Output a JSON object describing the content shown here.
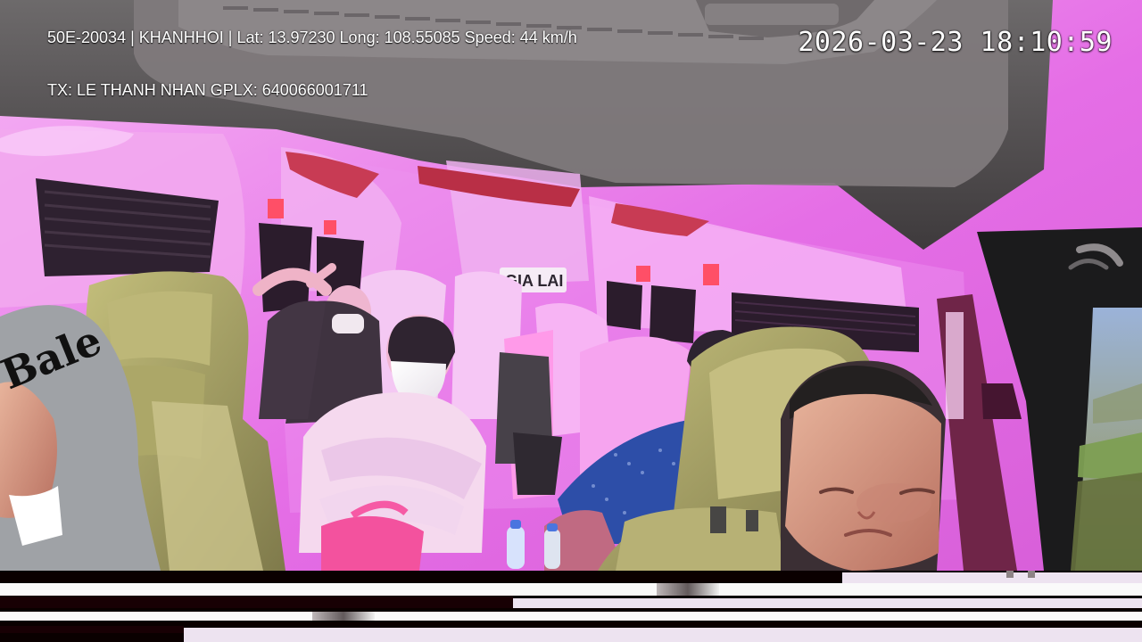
{
  "overlay": {
    "line1": "50E-20034 | KHANHHOI | Lat: 13.97230 Long: 108.55085 Speed: 44 km/h",
    "line2": "TX: LE THANH NHAN GPLX: 640066001711",
    "timestamp": "2026-03-23 18:10:59"
  },
  "scene": {
    "window_text": "GIA LAI",
    "hood_text": "Bale"
  },
  "colors": {
    "interior_pink": "#e26ae3",
    "interior_light": "#f3b7f4",
    "ceiling_gray": "#4e4a4d",
    "seat_olive": "#a39f5e",
    "driver_skin": "#d7a089",
    "window_green": "#7f9760",
    "accent_red": "#c83b54",
    "glitch_dark": "#0a0000"
  },
  "icons": {
    "seatbelt": "seatbelt-icon",
    "camera_blur": "blur-icon"
  }
}
